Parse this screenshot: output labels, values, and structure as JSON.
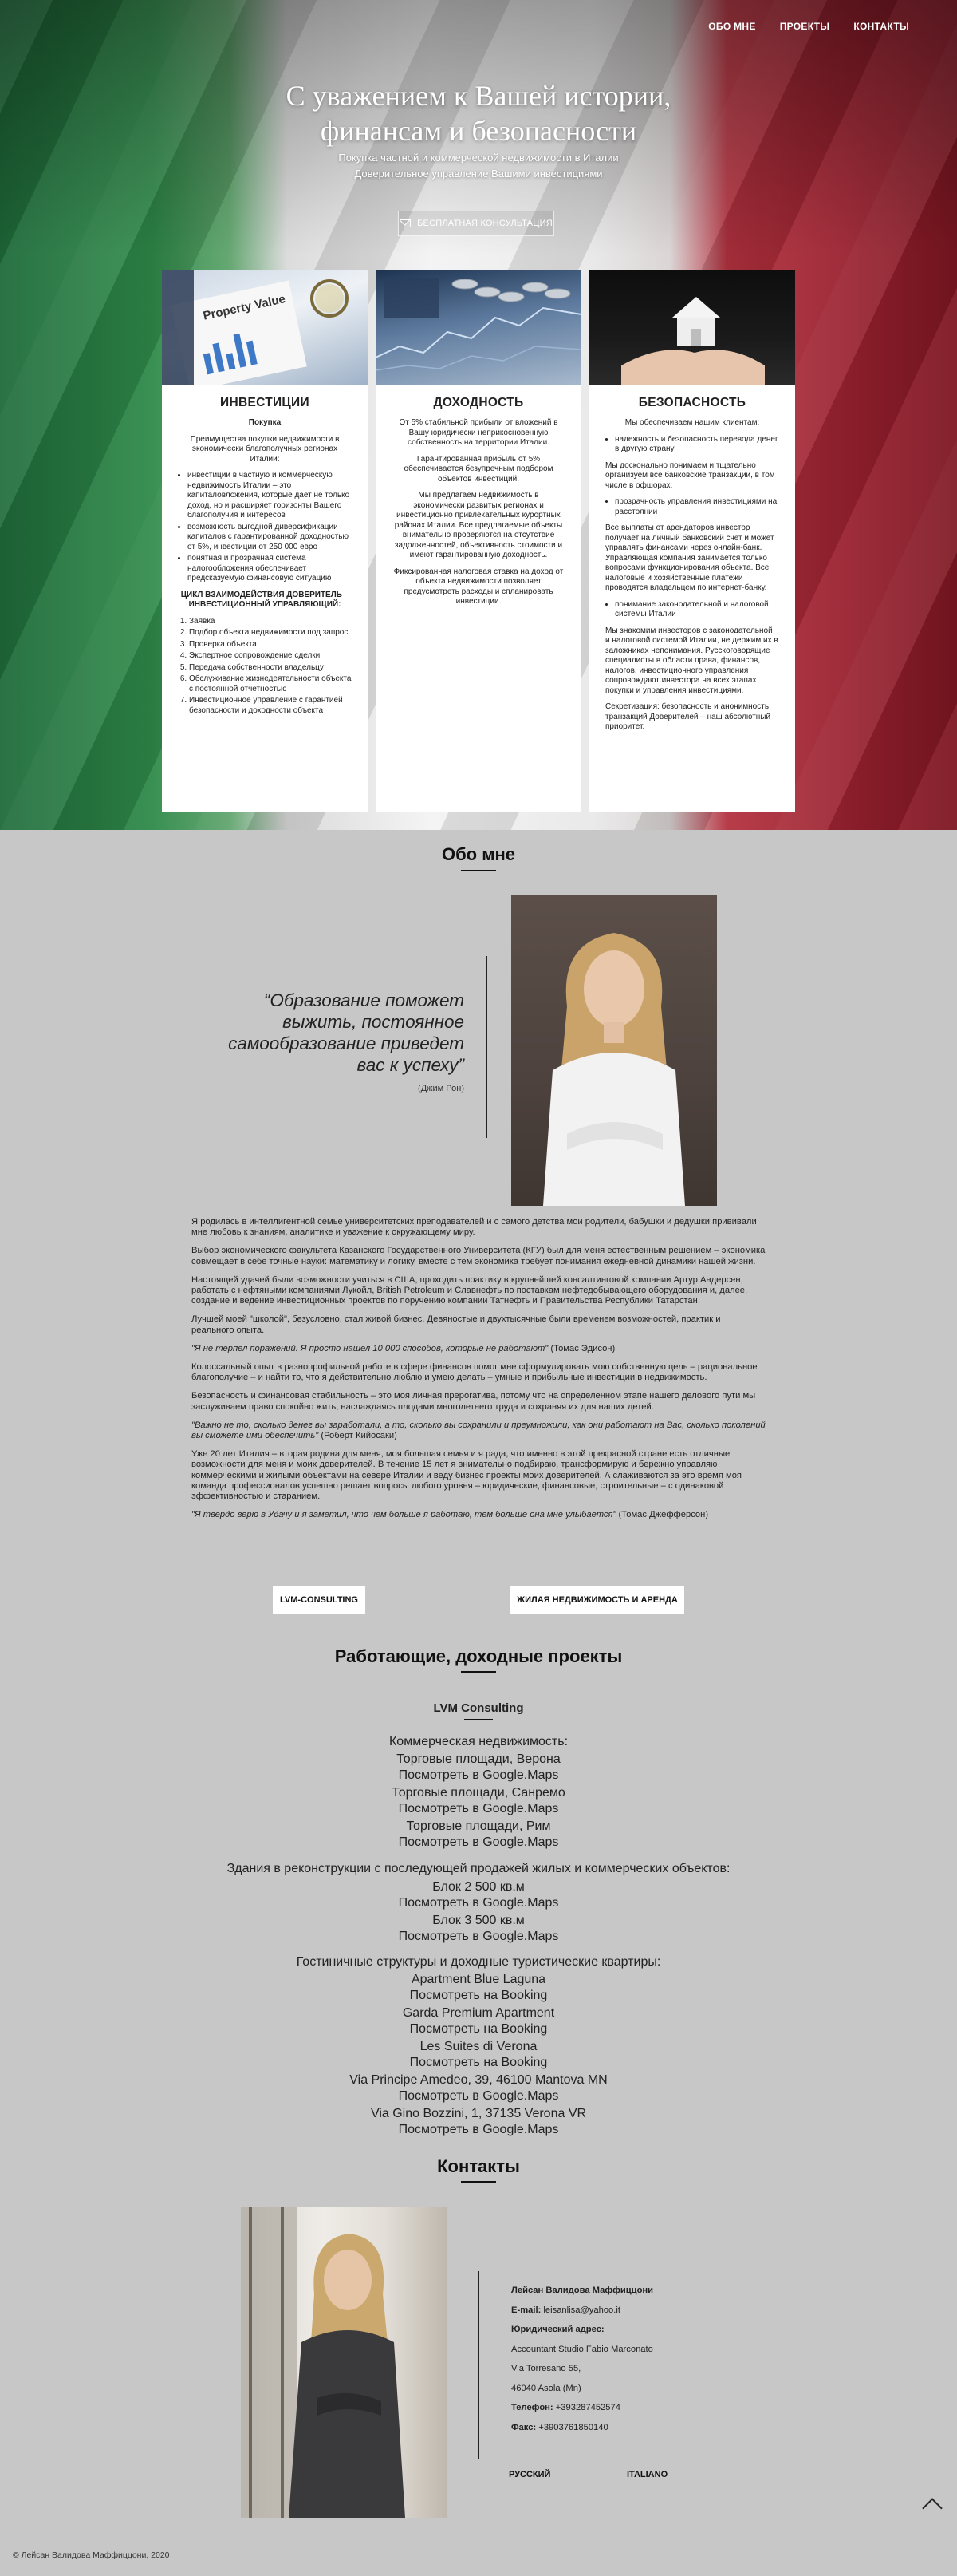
{
  "nav": [
    "ОБО МНЕ",
    "ПРОЕКТЫ",
    "КОНТАКТЫ"
  ],
  "hero": {
    "title_line1": "С уважением к Вашей истории,",
    "title_line2": "финансам и безопасности",
    "sub1": "Покупка частной и коммерческой недвижимости в Италии",
    "sub2": "Доверительное управление Вашими инвестициями",
    "cta": "БЕСПЛАТНАЯ КОНСУЛЬТАЦИЯ"
  },
  "cards": {
    "inv": {
      "image_caption": "Property Value",
      "title": "ИНВЕСТИЦИИ",
      "subtitle": "Покупка",
      "intro": "Преимущества покупки недвижимости в экономически благополучных регионах Италии:",
      "bullets": [
        "инвестиции в частную и коммерческую недвижимость Италии – это капиталовложения, которые дает не только доход, но и расширяет горизонты Вашего благополучия и интересов",
        "возможность выгодной диверсификации капиталов с гарантированной доходностью от 5%, инвестиции от 250 000 евро",
        "понятная и прозрачная система налогообложения обеспечивает предсказуемую финансовую ситуацию"
      ],
      "cycle_title": "ЦИКЛ ВЗАИМОДЕЙСТВИЯ ДОВЕРИТЕЛЬ – ИНВЕСТИЦИОННЫЙ УПРАВЛЯЮЩИЙ:",
      "steps": [
        "Заявка",
        "Подбор объекта недвижимости под запрос",
        "Проверка объекта",
        "Экспертное сопровождение сделки",
        "Передача собственности владельцу",
        "Обслуживание жизнедеятельности объекта с постоянной отчетностью",
        "Инвестиционное управление с гарантией безопасности и доходности объекта"
      ]
    },
    "profit": {
      "title": "ДОХОДНОСТЬ",
      "p1": "От 5% стабильной прибыли от вложений в Вашу юридически неприкосновенную собственность на территории Италии.",
      "p2": "Гарантированная прибыль от 5% обеспечивается безупречным подбором объектов инвестиций.",
      "p3": "Мы предлагаем недвижимость в экономически развитых регионах и инвестиционно привлекательных курортных районах Италии. Все предлагаемые объекты внимательно проверяются на отсутствие задолженностей, объективность стоимости и имеют гарантированную доходность.",
      "p4": "Фиксированная налоговая ставка на доход от объекта недвижимости позволяет предусмотреть расходы и спланировать инвестиции."
    },
    "safety": {
      "title": "БЕЗОПАСНОСТЬ",
      "intro": "Мы обеспечиваем нашим клиентам:",
      "b1": "надежность и безопасность перевода денег в другую страну",
      "t1": "Мы досконально понимаем и тщательно организуем все банковские транзакции, в том числе в офшорах.",
      "b2": "прозрачность управления инвестициями на расстоянии",
      "t2": "Все выплаты от арендаторов инвестор получает на личный банковский счет и может управлять финансами через онлайн-банк. Управляющая компания занимается только вопросами функционирования объекта. Все налоговые и хозяйственные платежи проводятся владельцем по интернет-банку.",
      "b3": "понимание законодательной и налоговой системы Италии",
      "t3": "Мы знакомим инвесторов с законодательной и налоговой системой Италии, не держим их в заложниках непонимания. Русскоговорящие специалисты в области права, финансов, налогов, инвестиционного управления сопровождают инвестора на всех этапах покупки и управления инвестициями.",
      "t4": "Секретизация: безопасность и анонимность транзакций Доверителей – наш абсолютный приоритет."
    }
  },
  "about": {
    "heading": "Обо мне",
    "quote": "“Образование поможет выжить, постоянное самообразование приведет вас к успеху”",
    "quote_author": "(Джим Рон)",
    "paragraphs": [
      "Я родилась в интеллигентной семье университетских преподавателей и с самого детства мои родители, бабушки и дедушки прививали мне любовь к знаниям, аналитике и уважение к окружающему миру.",
      "Выбор экономического факультета Казанского Государственного Университета (КГУ) был для меня естественным решением – экономика совмещает в себе точные науки: математику и логику, вместе с тем экономика требует понимания ежедневной динамики нашей жизни.",
      "Настоящей удачей были возможности учиться в США, проходить практику в крупнейшей консалтинговой компании Артур Андерсен, работать с нефтяными компаниями Лукойл, British Petroleum и Славнефть по поставкам нефтедобывающего оборудования и, далее, создание и ведение инвестиционных проектов по поручению компании Татнефть и Правительства Республики Татарстан.",
      "Лучшей моей \"школой\", безусловно, стал живой бизнес. Девяностые и двухтысячные были временем возможностей, практик и реального опыта."
    ],
    "quote2": "\"Я не терпел поражений. Я просто нашел 10 000 способов, которые не работают\"",
    "quote2_author": " (Томас Эдисон)",
    "para5": "Колоссальный опыт в разнопрофильной работе в сфере финансов помог мне сформулировать мою собственную цель – рациональное благополучие – и найти то, что я действительно люблю и умею делать – умные и прибыльные инвестиции в недвижимость.",
    "para6": "Безопасность и финансовая стабильность – это моя личная прерогатива, потому что на определенном этапе нашего делового пути мы заслуживаем право спокойно жить, наслаждаясь плодами многолетнего труда и сохраняя их для наших детей.",
    "quote3": "\"Важно не то, сколько денег вы заработали, а то, сколько вы сохранили и преумножили, как они работают на Вас, сколько поколений вы сможете ими обеспечить\"",
    "quote3_author": " (Роберт Кийосаки)",
    "para7": "Уже 20 лет Италия – вторая родина для меня, моя большая семья и я рада, что именно в этой прекрасной стране есть отличные возможности для меня и моих доверителей. В течение 15 лет я внимательно подбираю, трансформирую и бережно управляю коммерческими и жилыми объектами на севере Италии и веду бизнес проекты моих доверителей. А слаживаются за это время моя команда профессионалов успешно решает вопросы любого уровня – юридические, финансовые, строительные – с одинаковой эффективностью и старанием.",
    "quote4": "\"Я твердо верю в Удачу и я заметил, что чем больше я работаю, тем больше она мне улыбается\"",
    "quote4_author": " (Томас Джефферсон)",
    "btn1": "LVM-CONSULTING",
    "btn2": "ЖИЛАЯ НЕДВИЖИМОСТЬ И АРЕНДА"
  },
  "projects": {
    "heading": "Работающие, доходные проекты",
    "company": "LVM Consulting",
    "cat1": "Коммерческая недвижимость:",
    "p1": "Торговые площади, Верона",
    "p2": "Торговые площади, Санремо",
    "p3": "Торговые площади, Рим",
    "cat2": "Здания в реконструкции с последующей продажей жилых и коммерческих объектов:",
    "p4": "Блок 2 500 кв.м",
    "p5": "Блок 3 500 кв.м",
    "cat3": "Гостиничные структуры и доходные туристические квартиры:",
    "p6": "Apartment Blue Laguna",
    "p7": "Garda Premium Apartment",
    "p8": "Les Suites di Verona",
    "p9": "Via Principe Amedeo, 39, 46100 Mantova MN",
    "p10": "Via Gino Bozzini, 1, 37135 Verona VR",
    "maps": "Посмотреть в Google.Maps",
    "booking": "Посмотреть на Booking"
  },
  "contacts": {
    "heading": "Контакты",
    "name": "Лейсан Валидова Маффиццони",
    "email_label": "E-mail:",
    "email": " leisanlisa@yahoo.it",
    "addr_label": "Юридический адрес:",
    "addr1": "Accountant Studio Fabio Marconato",
    "addr2": "Via Torresano 55,",
    "addr3": "46040 Asola (Mn)",
    "phone_label": "Телефон:",
    "phone": " +393287452574",
    "fax_label": "Факс:",
    "fax": " +390376185014​0",
    "lang_ru": "РУССКИЙ",
    "lang_it": "ITALIANO"
  },
  "footer": "© Лейсан Валидова Маффиццони, 2020",
  "colors": {
    "italy_green": "#2f8a4a",
    "italy_red": "#9b2230",
    "section_bg": "#c7c7c7"
  }
}
